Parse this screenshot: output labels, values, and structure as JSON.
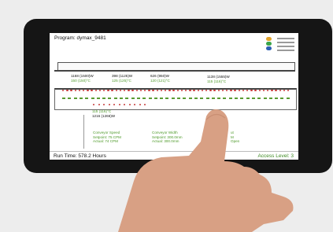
{
  "header": {
    "program": "Program: dymax_9481"
  },
  "zones": [
    {
      "power": "1168 (1500)W",
      "temp": "150 (150)°C"
    },
    {
      "power": "398 (1125)W",
      "temp": "125 (125)°C"
    },
    {
      "power": "626 (950)W",
      "temp": "120 (121)°C"
    },
    {
      "power": "1138 (1555)W",
      "temp": "115 (116)°C"
    }
  ],
  "bottom_zone": {
    "temp": "115 (116)°C",
    "power": "1216 (1266)W"
  },
  "conveyor_speed": {
    "title": "Conveyor Speed",
    "setpoint": "Setpoint: 75 CPM",
    "actual": "Actual: 74 CPM"
  },
  "conveyor_width": {
    "title": "Conveyor Width",
    "setpoint": "Setpoint: 300.0mm",
    "actual": "Actual: 300.0mm"
  },
  "partial_panel": {
    "line1": "ut",
    "line2": "M",
    "line3": "Open"
  },
  "status": {
    "run_time": "Run Time: 578.2 Hours",
    "access": "Access Level: 3"
  },
  "colors": {
    "accent_green": "#4e9a2a",
    "alarm_red": "#c73a3a",
    "signal_green": "#3aa54a",
    "signal_blue": "#2b5fb4"
  }
}
